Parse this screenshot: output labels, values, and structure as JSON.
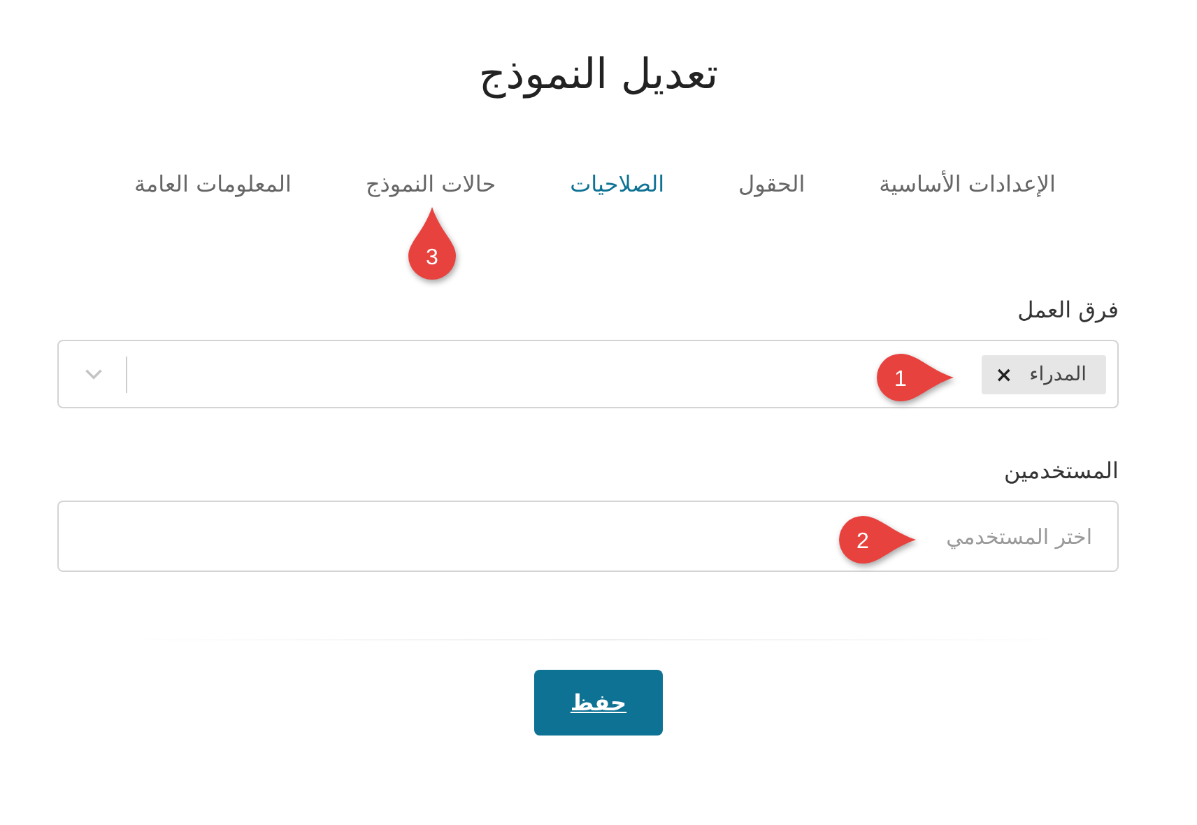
{
  "title": "تعديل النموذج",
  "tabs": [
    {
      "label": "الإعدادات الأساسية",
      "selected": false
    },
    {
      "label": "الحقول",
      "selected": false
    },
    {
      "label": "الصلاحيات",
      "selected": true
    },
    {
      "label": "حالات النموذج",
      "selected": false
    },
    {
      "label": "المعلومات العامة",
      "selected": false
    }
  ],
  "fields": [
    {
      "kind": "multiselect",
      "label": "فرق العمل",
      "tags": [
        {
          "text": "المدراء",
          "remove": "×"
        }
      ]
    },
    {
      "kind": "text",
      "label": "المستخدمين",
      "placeholder": "اختر المستخدمي"
    }
  ],
  "save_button": "حفظ",
  "callouts": [
    {
      "number": "1",
      "kind": "pin_right"
    },
    {
      "number": "2",
      "kind": "pin_right"
    },
    {
      "number": "3",
      "kind": "pin_up"
    }
  ]
}
